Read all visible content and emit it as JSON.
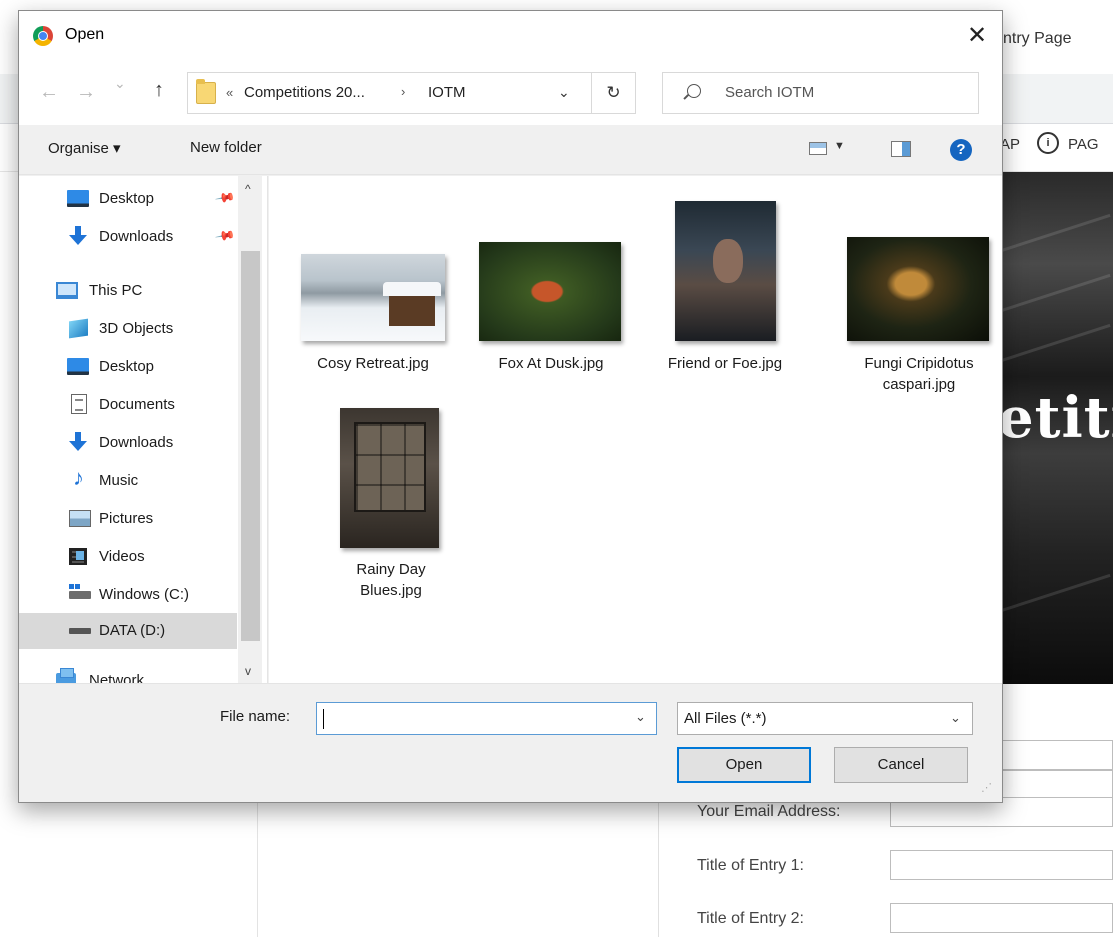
{
  "background": {
    "tab_title": "ntry Page",
    "nav_item_map": "AP",
    "nav_item_page": "PAG",
    "hero_text": "etitio",
    "form": {
      "email_label": "Your Email Address:",
      "entry1_label": "Title of Entry 1:",
      "entry2_label": "Title of Entry 2:"
    }
  },
  "dialog": {
    "title": "Open",
    "close_glyph": "✕",
    "nav": {
      "back_glyph": "←",
      "forward_glyph": "→",
      "recent_glyph": "⌄",
      "up_glyph": "↑",
      "breadcrumb_overflow": "«",
      "breadcrumb": [
        "Competitions 20...",
        "IOTM"
      ],
      "breadcrumb_separator": "›",
      "dropdown_glyph": "⌄",
      "refresh_glyph": "↻",
      "search_placeholder": "Search IOTM"
    },
    "toolbar": {
      "organise_label": "Organise ▾",
      "new_folder_label": "New folder",
      "view_caret": "▼",
      "help_glyph": "?"
    },
    "sidebar": {
      "scroll_up": "^",
      "scroll_down": "v",
      "pin_glyph": "📌",
      "items": [
        {
          "label": "Desktop",
          "icon": "desktop-icon",
          "pinned": true
        },
        {
          "label": "Downloads",
          "icon": "downloads-icon",
          "pinned": true
        },
        {
          "label": "This PC",
          "icon": "this-pc-icon"
        },
        {
          "label": "3D Objects",
          "icon": "3d-objects-icon"
        },
        {
          "label": "Desktop",
          "icon": "desktop-icon"
        },
        {
          "label": "Documents",
          "icon": "documents-icon"
        },
        {
          "label": "Downloads",
          "icon": "downloads-icon"
        },
        {
          "label": "Music",
          "icon": "music-icon",
          "glyph": "♪"
        },
        {
          "label": "Pictures",
          "icon": "pictures-icon"
        },
        {
          "label": "Videos",
          "icon": "videos-icon"
        },
        {
          "label": "Windows (C:)",
          "icon": "drive-c-icon"
        },
        {
          "label": "DATA (D:)",
          "icon": "drive-d-icon",
          "selected": true
        },
        {
          "label": "Network",
          "icon": "network-icon"
        }
      ]
    },
    "files": [
      {
        "name_line1": "Cosy Retreat.jpg",
        "name_line2": ""
      },
      {
        "name_line1": "Fox At Dusk.jpg",
        "name_line2": ""
      },
      {
        "name_line1": "Friend or Foe.jpg",
        "name_line2": ""
      },
      {
        "name_line1": "Fungi Cripidotus",
        "name_line2": "caspari.jpg"
      },
      {
        "name_line1": "Rainy Day",
        "name_line2": "Blues.jpg"
      }
    ],
    "footer": {
      "file_name_label": "File name:",
      "file_name_value": "",
      "dropdown_glyph": "⌄",
      "file_type_value": "All Files (*.*)",
      "open_label": "Open",
      "cancel_label": "Cancel",
      "grip_glyph": "⋰"
    }
  },
  "colors": {
    "accent": "#0078d7",
    "selection": "#d9d9d9",
    "help": "#1565c0"
  }
}
